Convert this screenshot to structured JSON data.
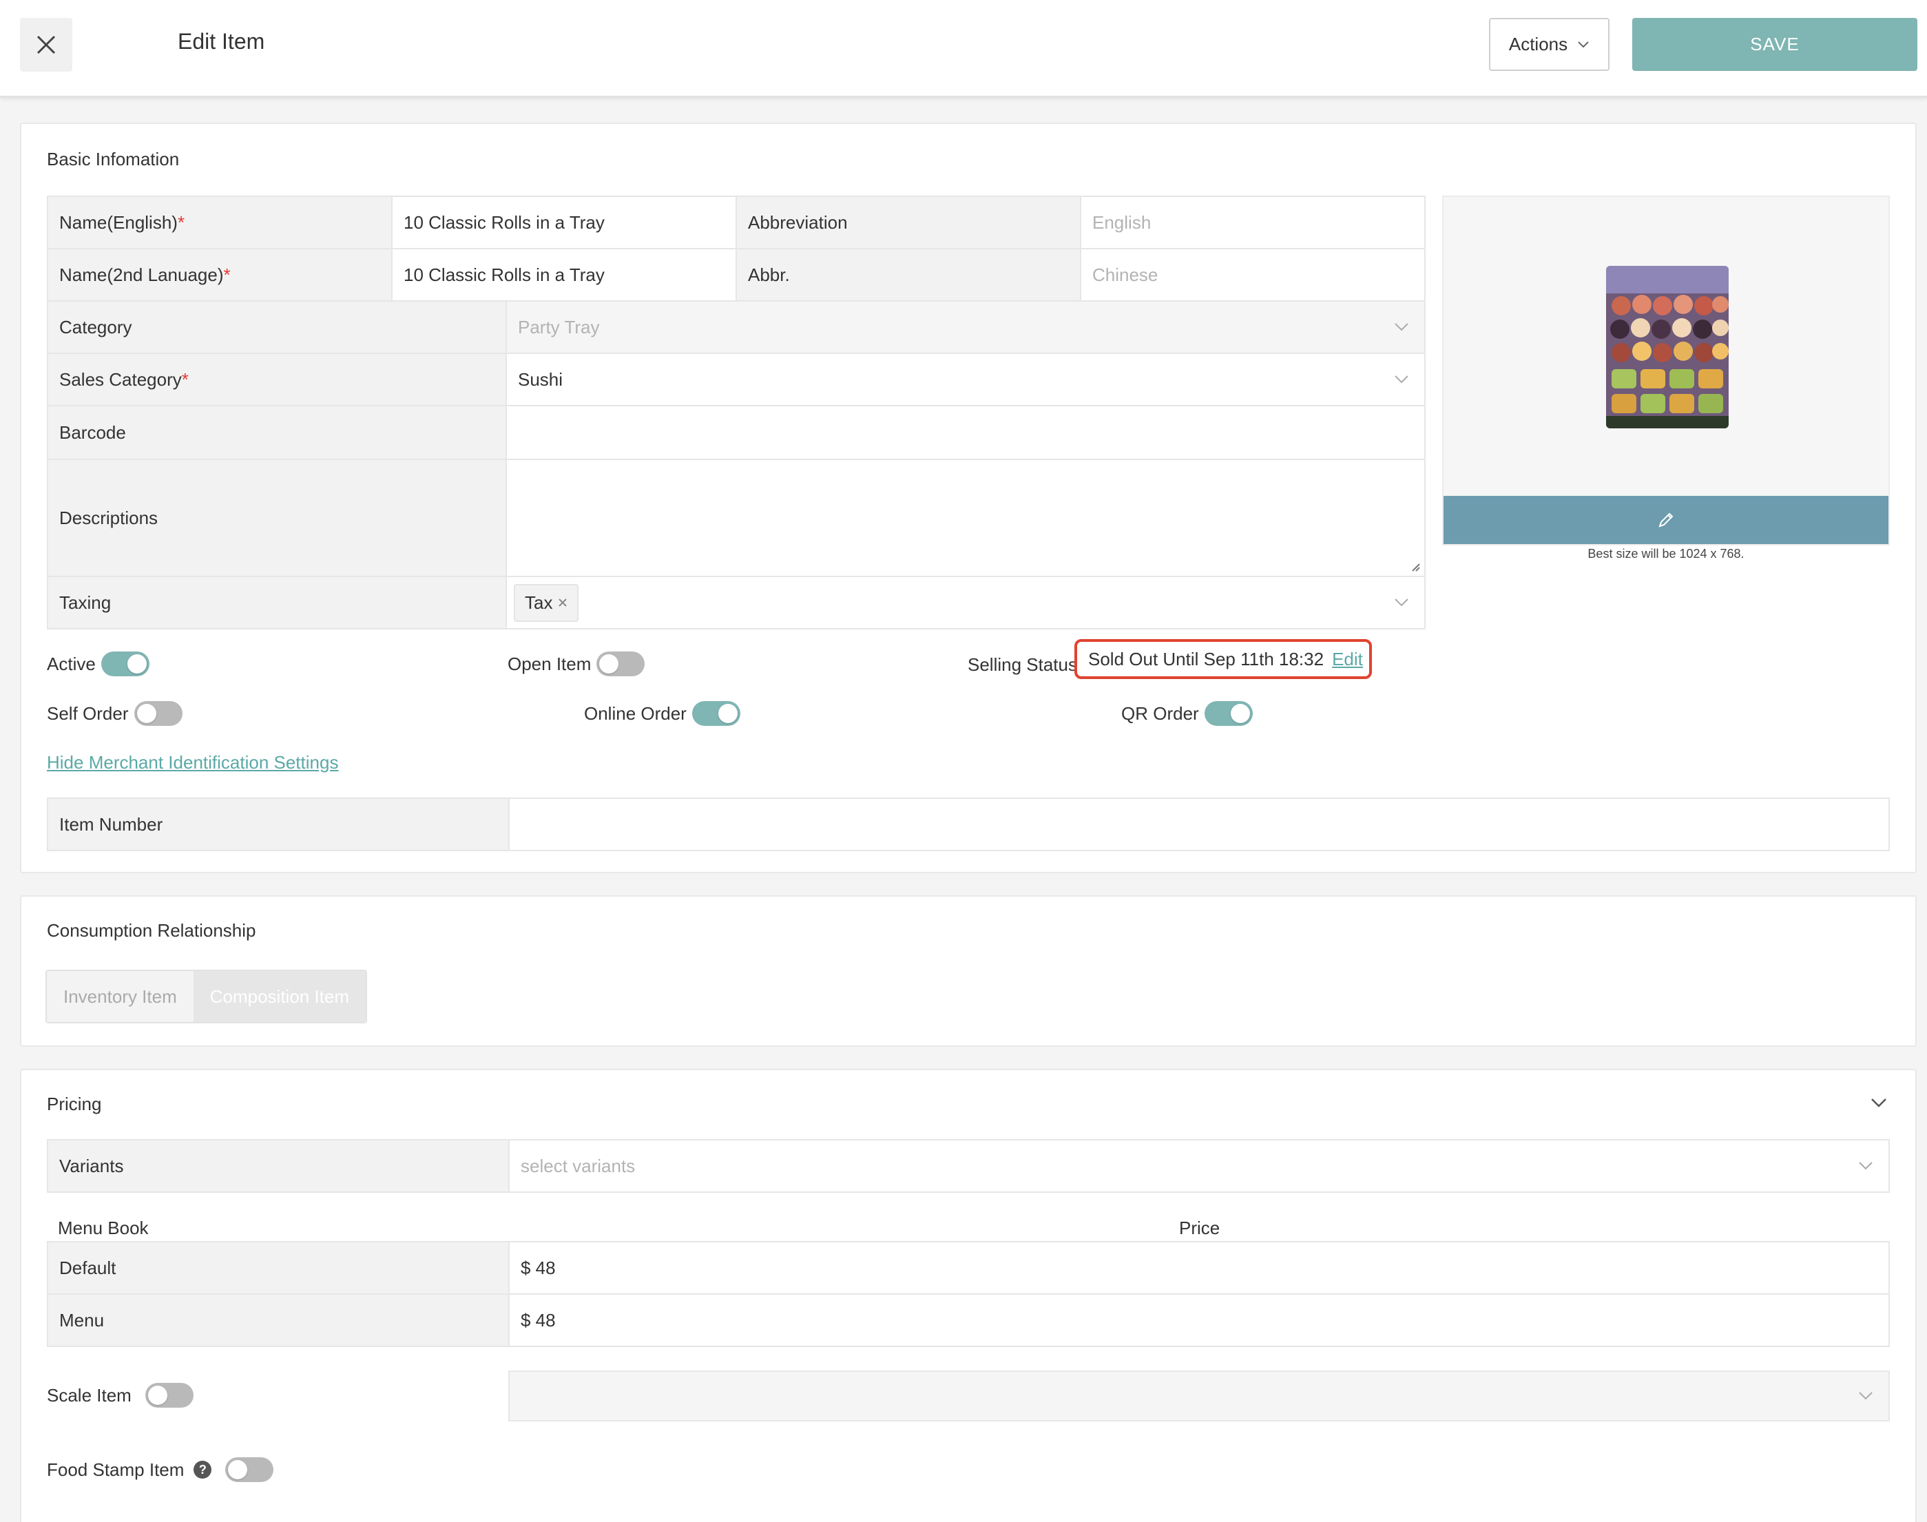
{
  "header": {
    "title": "Edit Item",
    "actions_label": "Actions",
    "save_label": "SAVE"
  },
  "basic": {
    "title": "Basic Infomation",
    "name_en_label": "Name(English)",
    "name_en_value": "10 Classic Rolls in a Tray",
    "abbr_label": "Abbreviation",
    "abbr_placeholder": "English",
    "name_2nd_label": "Name(2nd Lanuage)",
    "name_2nd_value": "10 Classic Rolls in a Tray",
    "abbr2_label": "Abbr.",
    "abbr2_placeholder": "Chinese",
    "category_label": "Category",
    "category_value": "Party Tray",
    "sales_category_label": "Sales Category",
    "sales_category_value": "Sushi",
    "barcode_label": "Barcode",
    "barcode_value": "",
    "descriptions_label": "Descriptions",
    "descriptions_value": "",
    "taxing_label": "Taxing",
    "tax_tag": "Tax",
    "required_mark": "*",
    "image_hint": "Best size will be 1024 x 768."
  },
  "toggles": {
    "active_label": "Active",
    "active_on": true,
    "open_item_label": "Open Item",
    "open_item_on": false,
    "selling_status_label": "Selling Status",
    "selling_status_value": "Sold Out Until Sep 11th 18:32",
    "selling_status_edit": "Edit",
    "self_order_label": "Self Order",
    "self_order_on": false,
    "online_order_label": "Online Order",
    "online_order_on": true,
    "qr_order_label": "QR Order",
    "qr_order_on": true
  },
  "merchant": {
    "toggle_link": "Hide Merchant Identification Settings",
    "item_number_label": "Item Number",
    "item_number_value": ""
  },
  "consumption": {
    "title": "Consumption Relationship",
    "tabs": [
      "Inventory Item",
      "Composition Item"
    ]
  },
  "pricing": {
    "title": "Pricing",
    "variants_label": "Variants",
    "variants_placeholder": "select variants",
    "menu_book_header": "Menu Book",
    "price_header": "Price",
    "rows": [
      {
        "label": "Default",
        "price": "$ 48"
      },
      {
        "label": "Menu",
        "price": "$ 48"
      }
    ],
    "scale_item_label": "Scale Item",
    "scale_item_on": false,
    "food_stamp_label": "Food Stamp Item",
    "food_stamp_on": false,
    "help_glyph": "?"
  },
  "colors": {
    "accent": "#7fb5b3",
    "image_bar": "#6c9cae",
    "required": "#e53935",
    "status_outline": "#e0432f"
  }
}
